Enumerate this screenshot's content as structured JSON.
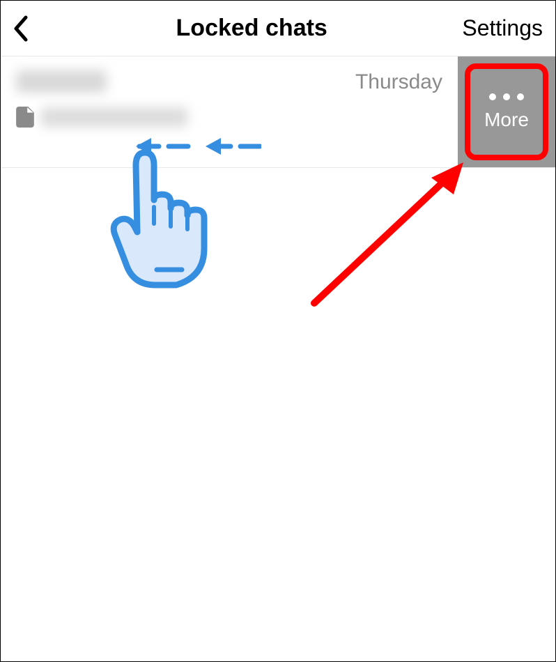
{
  "header": {
    "title": "Locked chats",
    "settings_label": "Settings"
  },
  "chat": {
    "date": "Thursday"
  },
  "swipe_action": {
    "more_label": "More"
  }
}
